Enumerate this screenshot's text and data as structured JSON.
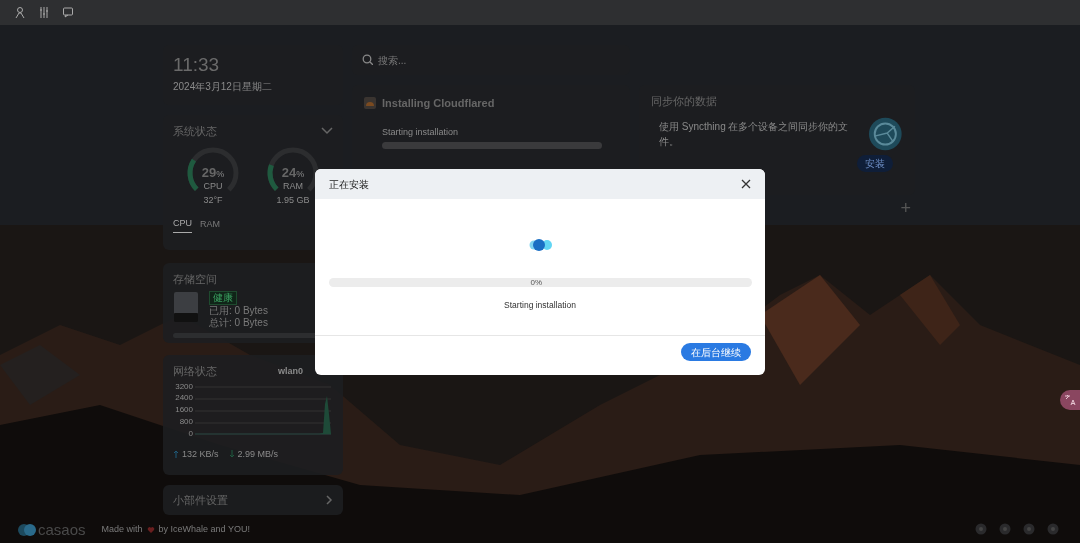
{
  "clock": {
    "time": "11:33",
    "date": "2024年3月12日星期二"
  },
  "system_status": {
    "title": "系统状态",
    "gauges": [
      {
        "value": "29",
        "unit": "%",
        "label": "CPU",
        "detail": "32°F",
        "level": 0.29
      },
      {
        "value": "24",
        "unit": "%",
        "label": "RAM",
        "detail": "1.95 GB",
        "level": 0.24
      }
    ],
    "tabs": [
      {
        "label": "CPU",
        "selected": true
      },
      {
        "label": "RAM",
        "selected": false
      }
    ]
  },
  "storage": {
    "title": "存储空间",
    "badge": "健康",
    "used": "已用: 0 Bytes",
    "total": "总计: 0 Bytes",
    "level": 0
  },
  "network": {
    "title": "网络状态",
    "interface": "wlan0",
    "y_labels": [
      "3200",
      "2400",
      "1600",
      "800",
      "0"
    ],
    "upload": "132 KB/s",
    "download": "2.99 MB/s"
  },
  "widget_settings": {
    "label": "小部件设置"
  },
  "footer": {
    "logo": "casaos",
    "made_with": "Made with",
    "by": "by IceWhale and YOU!"
  },
  "search": {
    "placeholder": "搜索..."
  },
  "install_card": {
    "title": "Installing Cloudflared",
    "status": "Starting installation",
    "level": 0
  },
  "sync_card": {
    "title": "同步你的数据",
    "text": "使用 Syncthing 在多个设备之间同步你的文件。",
    "button": "安装",
    "add": "+"
  },
  "dialog": {
    "title": "正在安装",
    "percent": "0%",
    "level": 0,
    "status": "Starting installation",
    "button": "在后台继续"
  }
}
